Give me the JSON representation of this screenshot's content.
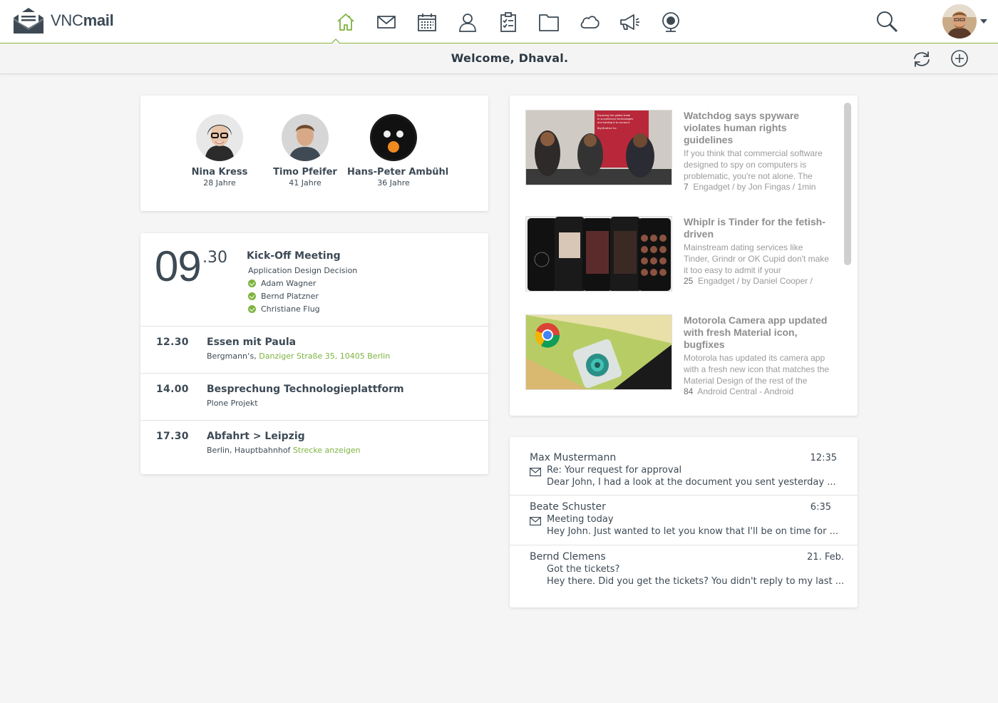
{
  "brand": {
    "name_light": "VNC",
    "name_bold": "mail",
    "accent": "#7db33f",
    "text": "#3d4a55"
  },
  "nav": {
    "items": [
      {
        "icon": "home-icon",
        "active": true
      },
      {
        "icon": "mail-icon"
      },
      {
        "icon": "calendar-icon"
      },
      {
        "icon": "contacts-icon"
      },
      {
        "icon": "tasks-icon"
      },
      {
        "icon": "folder-icon"
      },
      {
        "icon": "cloud-icon"
      },
      {
        "icon": "megaphone-icon"
      },
      {
        "icon": "webcam-icon"
      }
    ],
    "right": {
      "search_icon": "search-icon",
      "avatar_icon": "user-avatar",
      "caret_icon": "caret-down-icon"
    }
  },
  "subbar": {
    "welcome": "Welcome, Dhaval.",
    "refresh_icon": "refresh-icon",
    "add_icon": "plus-circle-icon"
  },
  "birthdays": [
    {
      "name": "Nina Kress",
      "age": "28 Jahre"
    },
    {
      "name": "Timo Pfeifer",
      "age": "41 Jahre"
    },
    {
      "name": "Hans-Peter Ambühl",
      "age": "36 Jahre"
    }
  ],
  "calendar": {
    "featured": {
      "hour": "09",
      "minute": ".30",
      "title": "Kick-Off Meeting",
      "subtitle": "Application Design Decision",
      "attendees": [
        "Adam Wagner",
        "Bernd Platzner",
        "Christiane Flug"
      ]
    },
    "events": [
      {
        "time": "12.30",
        "title": "Essen mit Paula",
        "sub_text": "Bergmann‘s, ",
        "sub_link": "Danziger Straße 35, 10405 Berlin"
      },
      {
        "time": "14.00",
        "title": "Besprechung Technologieplattform",
        "sub_text": "Plone Projekt",
        "sub_link": ""
      },
      {
        "time": "17.30",
        "title": "Abfahrt > Leipzig",
        "sub_text": "Berlin, Hauptbahnhof ",
        "sub_link": "Strecke anzeigen"
      }
    ]
  },
  "news": [
    {
      "title": "Watchdog says spyware violates human rights guidelines",
      "text": "If you think that commercial software designed to spy on computers is problematic, you're not alone. The",
      "count": "7",
      "source": "Engadget / by Jon Fingas / 1min",
      "image_text": "Exposing the global trade in surveillance technologies and holding it to account. Big Brother Inc."
    },
    {
      "title": "Whiplr is Tinder for the fetish-driven",
      "text": "Mainstream dating services like Tinder, Grindr or OK Cupid don't make it too easy to admit if your",
      "count": "25",
      "source": "Engadget / by Daniel Cooper /"
    },
    {
      "title": "Motorola Camera app updated with fresh Material icon, bugfixes",
      "text": "Motorola has updated its camera app with a fresh new icon that matches the Material Design of the rest of the",
      "count": "84",
      "source": "Android Central - Android"
    }
  ],
  "mails": [
    {
      "from": "Max Mustermann",
      "time": "12:35",
      "subject": "Re: Your request for approval",
      "preview": "Dear John, I had a look at the document you sent yesterday  ...",
      "icon": "envelope-icon"
    },
    {
      "from": "Beate Schuster",
      "time": "6:35",
      "subject": "Meeting today",
      "preview": "Hey John. Just wanted to let you know that I'll be on time for  ...",
      "icon": "envelope-icon"
    },
    {
      "from": "Bernd Clemens",
      "time": "21. Feb.",
      "subject": "Got the tickets?",
      "preview": "Hey there. Did you get the tickets? You didn't reply  to my last ...",
      "icon": ""
    }
  ]
}
